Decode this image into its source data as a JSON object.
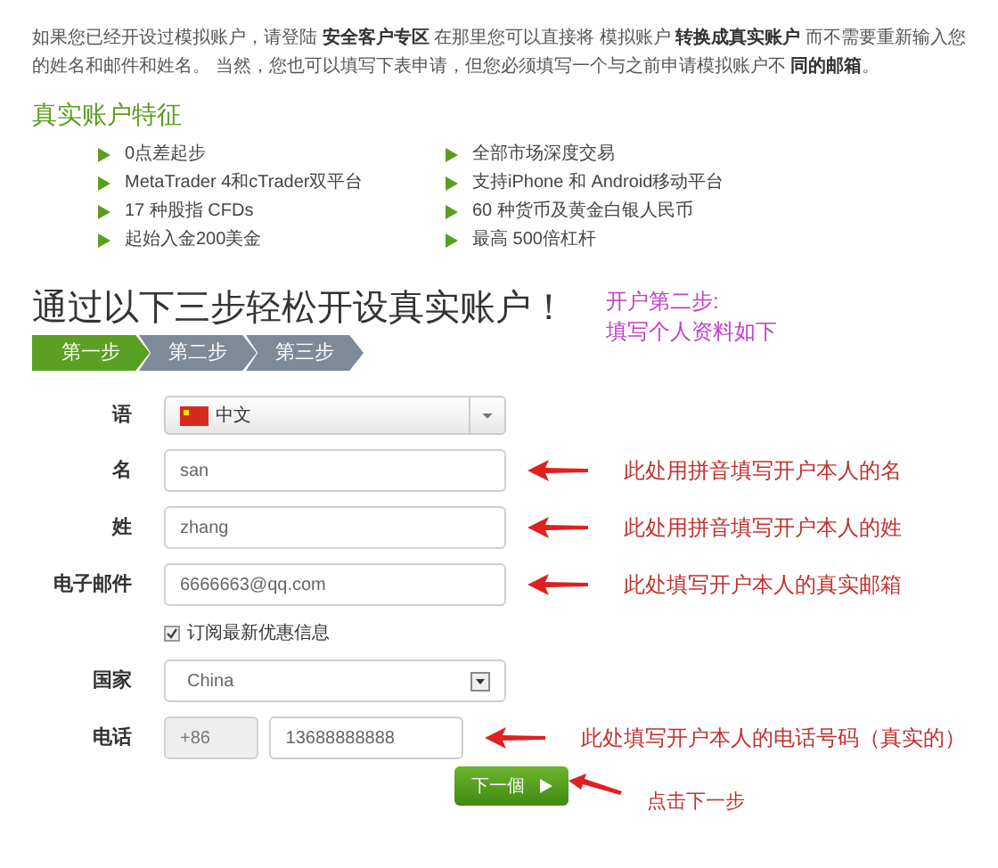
{
  "intro": "如果您已经开设过模拟账户，请登陆 **安全客户专区** 在那里您可以直接将 模拟账户 **转换成真实账户** 而不需要重新输入您的姓名和邮件和姓名。 当然，您也可以填写下表申请，但您必须填写一个与之前申请模拟账户不 **同的邮箱**。",
  "features_title": "真实账户特征",
  "features": [
    "0点差起步",
    "全部市场深度交易",
    "MetaTrader 4和cTrader双平台",
    "支持iPhone 和 Android移动平台",
    "17 种股指 CFDs",
    "60 种货币及黄金白银人民币",
    "起始入金200美金",
    "最高 500倍杠杆"
  ],
  "title": "通过以下三步轻松开设真实账户！",
  "title_note": [
    "开户第二步:",
    "填写个人资料如下"
  ],
  "steps": [
    {
      "label": "第一步",
      "selected": true
    },
    {
      "label": "第二步",
      "selected": false
    },
    {
      "label": "第三步",
      "selected": false
    }
  ],
  "form": [
    {
      "kind": "language",
      "label": "语",
      "value": "中文"
    },
    {
      "kind": "text",
      "label": "名",
      "value": "san",
      "note": "此处用拼音填写开户本人的名"
    },
    {
      "kind": "text",
      "label": "姓",
      "value": "zhang",
      "note": "此处用拼音填写开户本人的姓"
    },
    {
      "kind": "text",
      "label": "电子邮件",
      "value": "6666663@qq.com",
      "note": "此处填写开户本人的真实邮箱"
    },
    {
      "kind": "checkbox",
      "label": "订阅最新优惠信息",
      "checked": true
    },
    {
      "kind": "select",
      "label": "国家",
      "value": "China"
    },
    {
      "kind": "phone",
      "label": "电话",
      "code": "+86",
      "value": "13688888888",
      "note": "此处填写开户本人的电话号码（真实的）"
    }
  ],
  "next_button": "下一個",
  "next_note": "点击下一步"
}
